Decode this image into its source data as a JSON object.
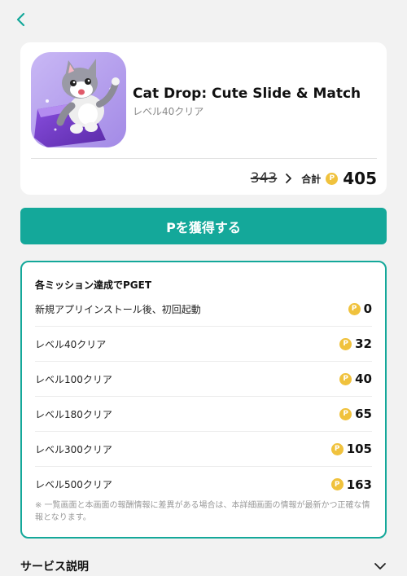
{
  "app": {
    "title": "Cat Drop: Cute Slide & Match",
    "subtitle": "レベル40クリア",
    "old_points": "343",
    "total_label": "合計",
    "total_points": "405"
  },
  "cta_label": "Pを獲得する",
  "missions": {
    "heading": "各ミッション達成でPGET",
    "items": [
      {
        "label": "新規アプリインストール後、初回起動",
        "points": "0"
      },
      {
        "label": "レベル40クリア",
        "points": "32"
      },
      {
        "label": "レベル100クリア",
        "points": "40"
      },
      {
        "label": "レベル180クリア",
        "points": "65"
      },
      {
        "label": "レベル300クリア",
        "points": "105"
      },
      {
        "label": "レベル500クリア",
        "points": "163"
      }
    ],
    "note": "※ 一覧画面と本画面の報酬情報に差異がある場合は、本詳細画面の情報が最新かつ正確な情報となります。"
  },
  "service_label": "サービス説明",
  "coin_letter": "P",
  "icons": {
    "back": "chevron-left-icon",
    "arrow": "chevron-right-icon",
    "coin": "point-coin-icon",
    "expand": "chevron-down-icon"
  },
  "colors": {
    "accent": "#14a89a",
    "coin": "#f0c23d",
    "background": "#f2f2f2"
  }
}
